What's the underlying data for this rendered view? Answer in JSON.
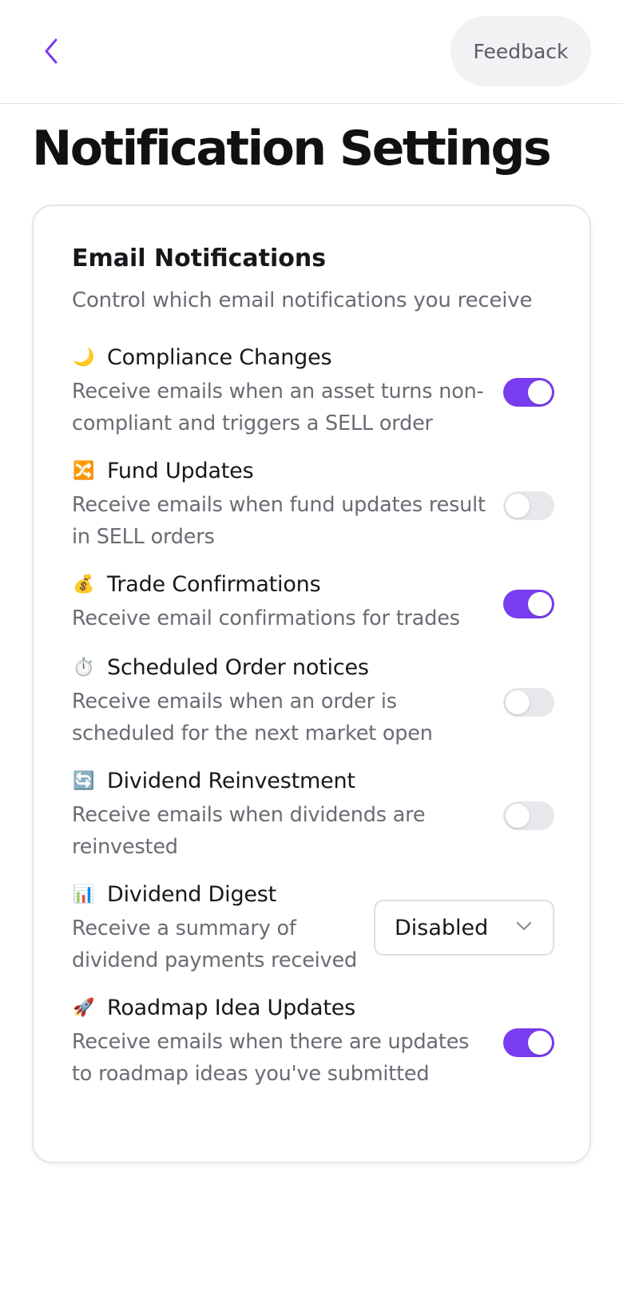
{
  "header": {
    "feedback_label": "Feedback"
  },
  "page": {
    "title": "Notification Settings"
  },
  "card": {
    "title": "Email Notifications",
    "subtitle": "Control which email notifications you receive"
  },
  "settings": [
    {
      "emoji": "🌙",
      "icon": "moon-icon",
      "title": "Compliance Changes",
      "description": "Receive emails when an asset turns non-compliant and triggers a SELL order",
      "enabled": true
    },
    {
      "emoji": "🔀",
      "icon": "shuffle-icon",
      "title": "Fund Updates",
      "description": "Receive emails when fund updates result in SELL orders",
      "enabled": false
    },
    {
      "emoji": "💰",
      "icon": "money-bag-icon",
      "title": "Trade Confirmations",
      "description": "Receive email confirmations for trades",
      "enabled": true
    },
    {
      "emoji": "⏱️",
      "icon": "stopwatch-icon",
      "title": "Scheduled Order notices",
      "description": "Receive emails when an order is scheduled for the next market open",
      "enabled": false
    },
    {
      "emoji": "🔄",
      "icon": "refresh-icon",
      "title": "Dividend Reinvestment",
      "description": "Receive emails when dividends are reinvested",
      "enabled": false
    },
    {
      "emoji": "📊",
      "icon": "bar-chart-icon",
      "title": "Dividend Digest",
      "description": "Receive a summary of dividend payments received",
      "select_value": "Disabled"
    },
    {
      "emoji": "🚀",
      "icon": "rocket-icon",
      "title": "Roadmap Idea Updates",
      "description": "Receive emails when there are updates to roadmap ideas you've submitted",
      "enabled": true
    }
  ],
  "colors": {
    "accent": "#7a3cf0",
    "toggle_off": "#e8e8ec",
    "muted_text": "#6b6b74"
  }
}
